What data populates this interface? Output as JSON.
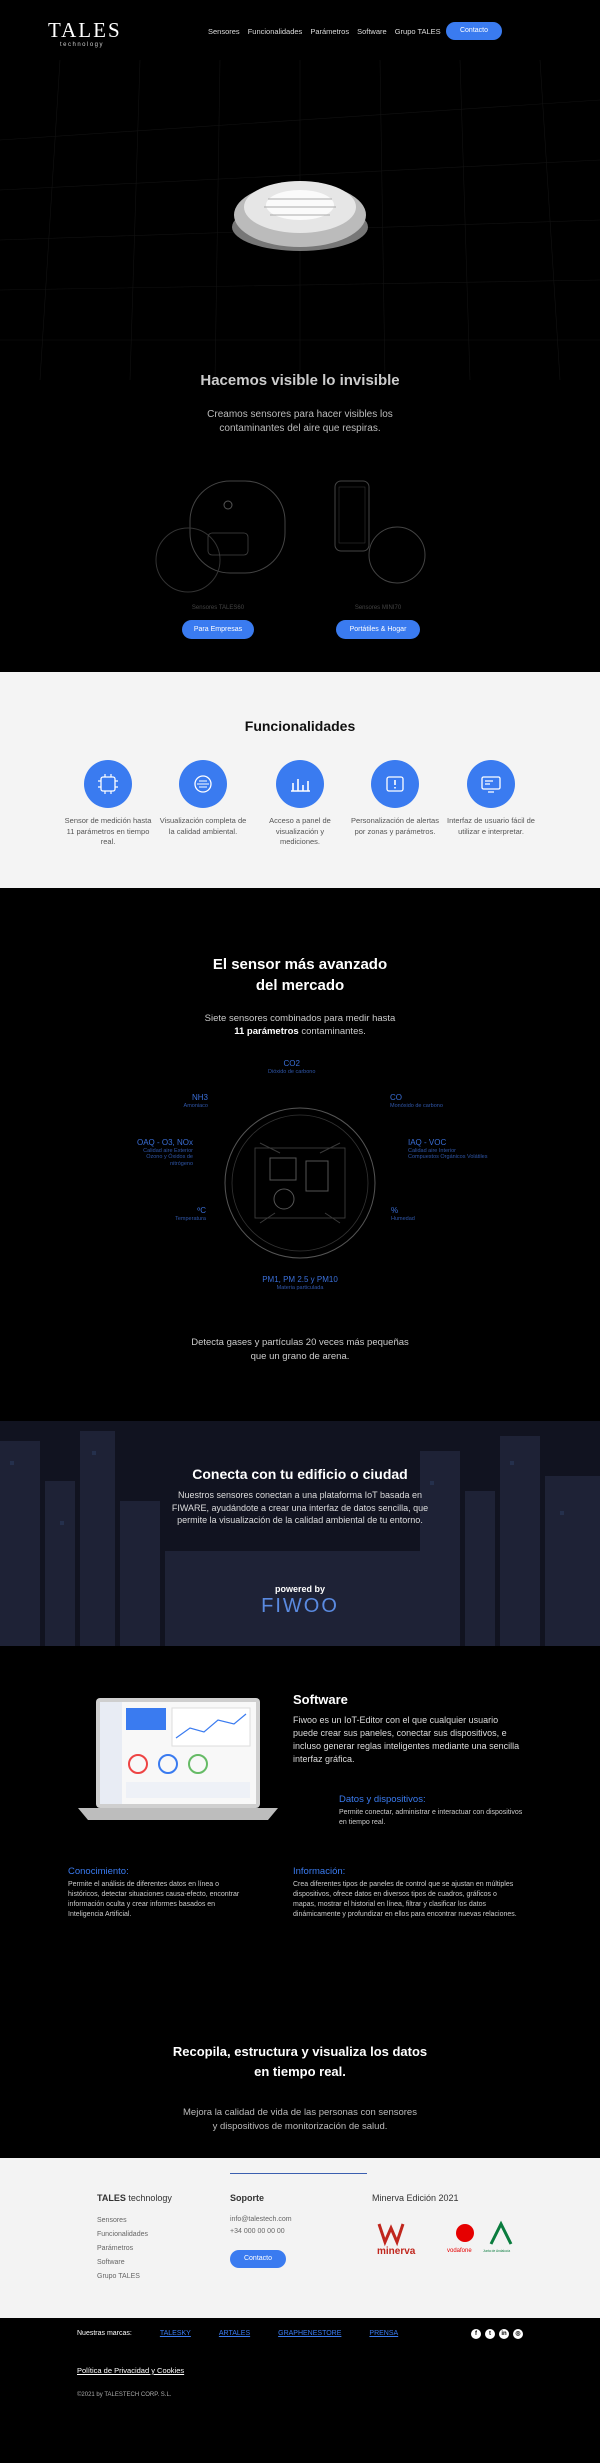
{
  "header": {
    "logo_main": "TALES",
    "logo_sub": "technology",
    "menu": [
      "Sensores",
      "Funcionalidades",
      "Parámetros",
      "Software",
      "Grupo TALES"
    ],
    "cta": "Contacto"
  },
  "hero": {
    "title": "Hacemos visible lo invisible",
    "subtitle": "Creamos sensores para hacer visibles los contaminantes del aire que respiras.",
    "products": [
      {
        "label": "Sensores TALES60",
        "button": "Para Empresas"
      },
      {
        "label": "Sensores MINI70",
        "button": "Portátiles & Hogar"
      }
    ]
  },
  "funcionalidades": {
    "title": "Funcionalidades",
    "items": [
      {
        "icon": "sensor-chip-icon",
        "text": "Sensor de medición hasta 11 parámetros en tiempo real."
      },
      {
        "icon": "air-quality-icon",
        "text": "Visualización completa de la calidad ambiental."
      },
      {
        "icon": "bar-chart-icon",
        "text": "Acceso a panel de visualización y mediciones."
      },
      {
        "icon": "alert-settings-icon",
        "text": "Personalización de alertas por zonas y parámetros."
      },
      {
        "icon": "interface-icon",
        "text": "Interfaz de usuario fácil de utilizar e interpretar."
      }
    ]
  },
  "sensor": {
    "title_line1": "El sensor más avanzado",
    "title_line2": "del mercado",
    "desc_pre": "Siete sensores combinados para medir hasta",
    "desc_bold": "11 parámetros",
    "desc_post": "contaminantes.",
    "gases": [
      {
        "name": "CO2",
        "desc": "Dióxido de carbono"
      },
      {
        "name": "CO",
        "desc": "Monóxido de carbono"
      },
      {
        "name": "NH3",
        "desc": "Amoniaco"
      },
      {
        "name": "IAQ - VOC",
        "desc": "Calidad aire Interior\nCompuestos Orgánicos Volátiles"
      },
      {
        "name": "OAQ - O3, NOx",
        "desc": "Calidad aire Exterior\nOzono y Óxidos de nitrógeno"
      },
      {
        "name": "%",
        "desc": "Humedad"
      },
      {
        "name": "ºC",
        "desc": "Temperatura"
      },
      {
        "name": "PM1, PM 2.5 y PM10",
        "desc": "Materia particulada"
      }
    ],
    "footer": "Detecta gases y partículas 20 veces más pequeñas que un grano de arena."
  },
  "connect": {
    "title": "Conecta con tu edificio o ciudad",
    "text": "Nuestros sensores conectan a una plataforma IoT basada en FIWARE, ayudándote a crear una interfaz de datos sencilla, que permite la visualización de la calidad ambiental de tu entorno.",
    "powered": "powered by",
    "brand": "FIWOO"
  },
  "software": {
    "title": "Software",
    "text": "Fiwoo es un IoT-Editor con el que cualquier usuario puede crear sus paneles, conectar sus dispositivos, e incluso generar reglas inteligentes mediante una sencilla interfaz gráfica.",
    "datos_title": "Datos y dispositivos:",
    "datos_text": "Permite conectar, administrar e interactuar con dispositivos en tiempo real.",
    "conocimiento_title": "Conocimiento:",
    "conocimiento_text": "Permite el análisis de diferentes datos en línea o históricos, detectar situaciones causa-efecto, encontrar información oculta y crear informes basados en Inteligencia Artificial.",
    "informacion_title": "Información:",
    "informacion_text": "Crea diferentes tipos de paneles de control que se ajustan en múltiples dispositivos, ofrece datos en diversos tipos de cuadros, gráficos o mapas, mostrar el historial en línea, filtrar y clasificar los datos dinámicamente y profundizar en ellos para encontrar nuevas relaciones.",
    "recopila_line1": "Recopila, estructura y visualiza los datos",
    "recopila_line2": "en tiempo real.",
    "recopila_text": "Mejora la calidad de vida de las personas con sensores y dispositivos de monitorización de salud."
  },
  "footer": {
    "brand_bold": "TALES",
    "brand_rest": "technology",
    "links": [
      "Sensores",
      "Funcionalidades",
      "Parámetros",
      "Software",
      "Grupo TALES"
    ],
    "soporte_title": "Soporte",
    "email": "info@talestech.com",
    "phone": "+34 000 00 00 00",
    "contact_btn": "Contacto",
    "minerva_title": "Minerva Edición 2021",
    "minerva_logo": "minerva",
    "vodafone_logo": "vodafone",
    "junta_logo": "Junta de Andalucía"
  },
  "bottom": {
    "marcas_label": "Nuestras marcas:",
    "marcas": [
      "TALESKY",
      "ARTALES",
      "GRAPHENESTORE",
      "PRENSA"
    ],
    "social": [
      "facebook-icon",
      "twitter-icon",
      "linkedin-icon",
      "instagram-icon"
    ],
    "privacy": "Política de Privacidad y Cookies",
    "copyright": "©2021 by TALESTECH CORP. S.L."
  }
}
